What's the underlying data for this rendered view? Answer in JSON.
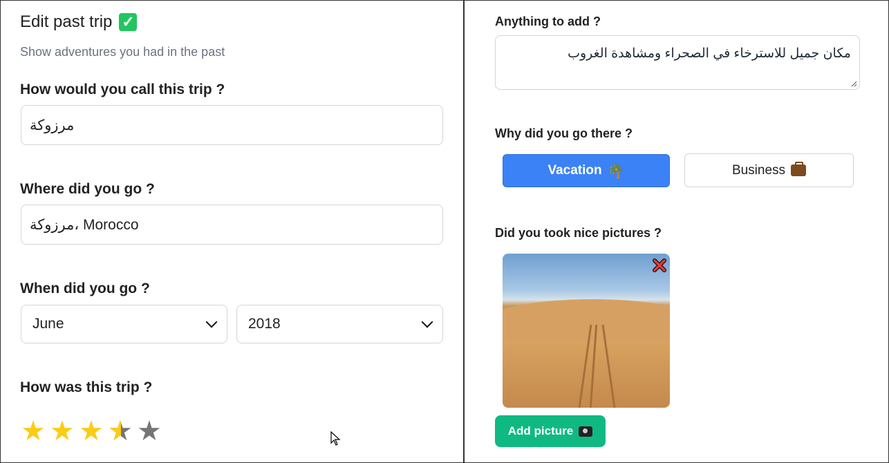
{
  "form": {
    "title": "Edit past trip",
    "title_icon": "check-mark-icon",
    "subtitle": "Show adventures you had in the past",
    "name_label": "How would you call this trip ?",
    "name_value": "مرزوكة",
    "where_label": "Where did you go ?",
    "where_value": "مرزوكة، Morocco",
    "when_label": "When did you go ?",
    "month_value": "June",
    "year_value": "2018",
    "rating_label": "How was this trip ?",
    "rating": 3.5,
    "rating_max": 5,
    "notes_label": "Anything to add ?",
    "notes_value": "مكان جميل للاسترخاء في الصحراء ومشاهدة الغروب",
    "why_label": "Why did you go there ?",
    "vacation_label": "Vacation",
    "business_label": "Business",
    "pictures_label": "Did you took nice pictures ?",
    "add_picture_label": "Add picture"
  },
  "colors": {
    "primary": "#3b82f6",
    "success": "#10b981",
    "star": "#facc15",
    "star_empty": "#757575"
  },
  "icons": {
    "vacation": "palm-tree-icon",
    "business": "briefcase-icon",
    "add_picture": "camera-icon",
    "remove_picture": "close-icon"
  }
}
